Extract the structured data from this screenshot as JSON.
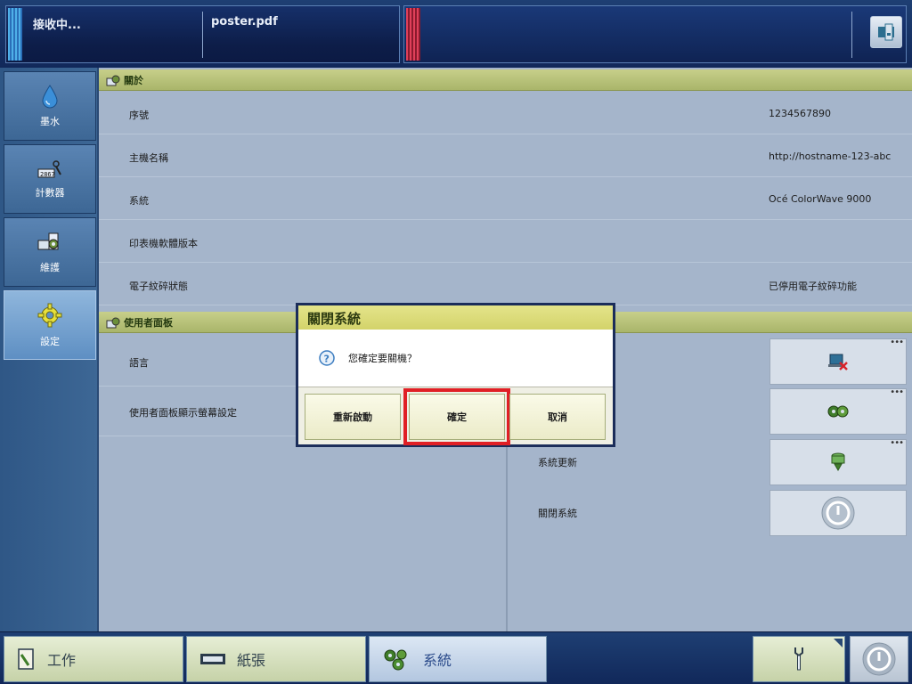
{
  "topbar": {
    "job_status": "接收中...",
    "file_name": "poster.pdf"
  },
  "nav": {
    "items": [
      {
        "label": "墨水",
        "icon": "ink-drop-icon"
      },
      {
        "label": "計數器",
        "icon": "counter-icon"
      },
      {
        "label": "維護",
        "icon": "maintenance-icon"
      },
      {
        "label": "設定",
        "icon": "gear-icon",
        "active": true
      }
    ]
  },
  "about": {
    "header": "關於",
    "rows": [
      {
        "label": "序號",
        "value": "1234567890"
      },
      {
        "label": "主機名稱",
        "value": "http://hostname-123-abc"
      },
      {
        "label": "系統",
        "value": "Océ ColorWave 9000"
      },
      {
        "label": "印表機軟體版本",
        "value": ""
      },
      {
        "label": "電子紋碎狀態",
        "value": "已停用電子紋碎功能"
      }
    ]
  },
  "user_panel": {
    "header": "使用者面板",
    "rows": [
      {
        "label": "語言"
      },
      {
        "label": "使用者面板顯示螢幕設定"
      }
    ]
  },
  "system_panel": {
    "rows": [
      {
        "label": "",
        "icon": "laptop-error-icon"
      },
      {
        "label": "",
        "icon": "gear-cluster-icon"
      },
      {
        "label": "系統更新",
        "icon": "system-update-icon"
      },
      {
        "label": "關閉系統",
        "icon": "power-icon"
      }
    ]
  },
  "dialog": {
    "title": "關閉系統",
    "message": "您確定要關機？",
    "restart_label": "重新啟動",
    "confirm_label": "確定",
    "cancel_label": "取消"
  },
  "bottombar": {
    "tabs": [
      {
        "label": "工作",
        "icon": "job-icon"
      },
      {
        "label": "紙張",
        "icon": "paper-icon"
      },
      {
        "label": "系統",
        "icon": "system-gears-icon",
        "active": true
      }
    ]
  },
  "colors": {
    "accent": "#e01f25",
    "header_green": "#a9b56a",
    "nav_blue": "#3d6795"
  }
}
